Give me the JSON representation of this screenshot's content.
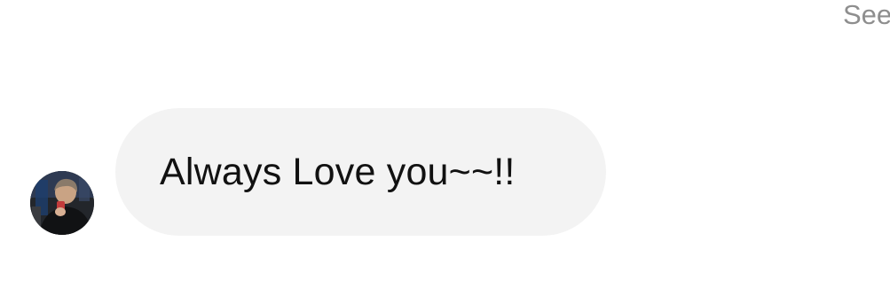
{
  "conversation": {
    "seen_label": "Seen",
    "messages": [
      {
        "sender": "other",
        "text": "Always Love you~~!!"
      }
    ]
  },
  "colors": {
    "bubble_background": "#f3f3f3",
    "message_text": "#111111",
    "status_text": "#8e8e8e",
    "page_background": "#ffffff"
  }
}
